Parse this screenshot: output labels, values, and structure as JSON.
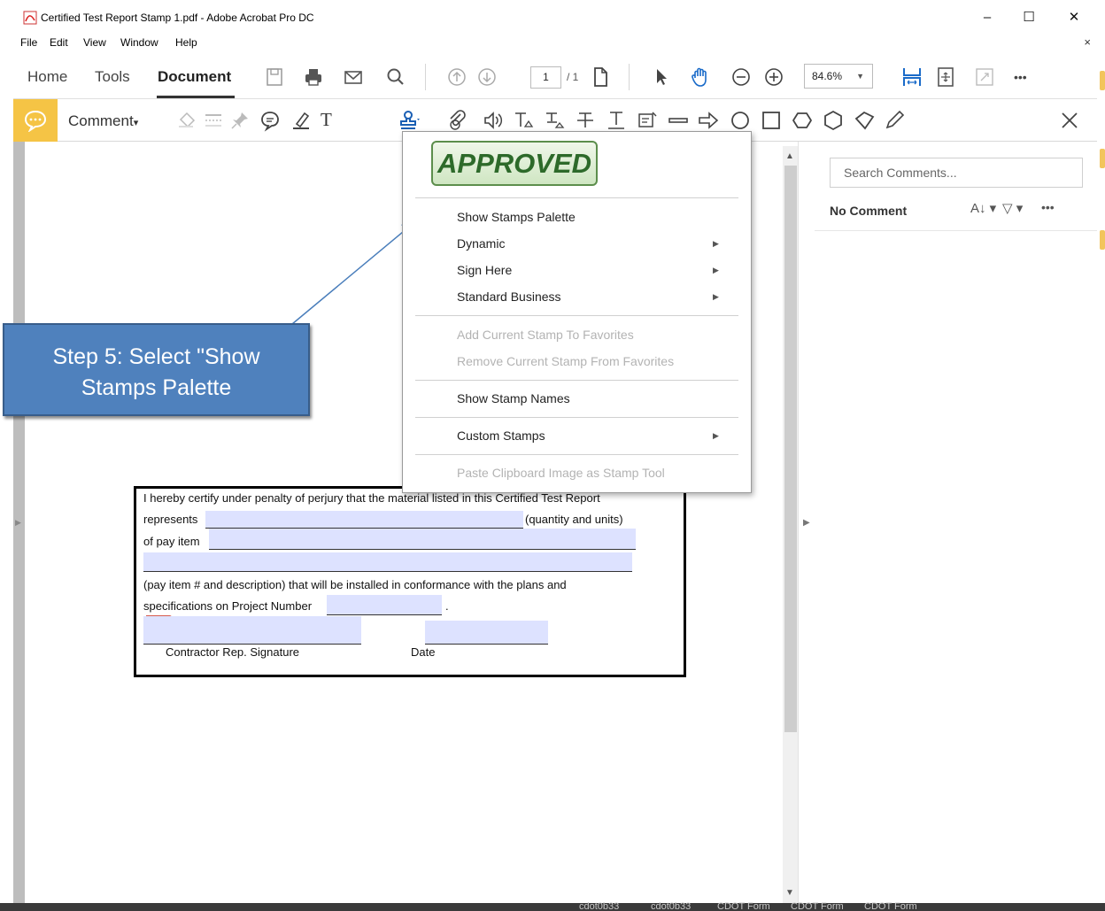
{
  "window": {
    "title": "Certified Test Report Stamp 1.pdf - Adobe Acrobat Pro DC",
    "minimize": "–",
    "maximize": "☐",
    "close": "✕"
  },
  "menu": {
    "items": [
      "File",
      "Edit",
      "View",
      "Window",
      "Help"
    ],
    "close": "×"
  },
  "toolbar": {
    "tabs": [
      "Home",
      "Tools",
      "Document"
    ],
    "active_tab": "Document",
    "page_current": "1",
    "page_total": "/ 1",
    "zoom": "84.6%",
    "more": "•••"
  },
  "comment_toolbar": {
    "label": "Comment",
    "label_arrow": "▾"
  },
  "stamp_menu": {
    "preview_stamp": "APPROVED",
    "items": [
      {
        "label": "Show Stamps Palette",
        "submenu": false,
        "enabled": true
      },
      {
        "label": "Dynamic",
        "submenu": true,
        "enabled": true
      },
      {
        "label": "Sign Here",
        "submenu": true,
        "enabled": true
      },
      {
        "label": "Standard Business",
        "submenu": true,
        "enabled": true
      },
      {
        "label": "Add Current Stamp To Favorites",
        "submenu": false,
        "enabled": false
      },
      {
        "label": "Remove Current Stamp From Favorites",
        "submenu": false,
        "enabled": false
      },
      {
        "label": "Show Stamp Names",
        "submenu": false,
        "enabled": true
      },
      {
        "label": "Custom Stamps",
        "submenu": true,
        "enabled": true
      },
      {
        "label": "Paste Clipboard Image as Stamp Tool",
        "submenu": false,
        "enabled": false
      }
    ]
  },
  "callout": {
    "line1": "Step 5: Select \"Show",
    "line2": "Stamps Palette"
  },
  "right_panel": {
    "search_placeholder": "Search Comments...",
    "no_comment": "No Comment"
  },
  "form": {
    "line1": "I hereby certify under penalty of perjury that the material listed in this Certified Test Report",
    "represents": "represents",
    "quantity_units": "(quantity and units)",
    "of_pay_item": "of pay item",
    "pay_item_desc": "(pay item # and description)  that will be installed in conformance with the plans and",
    "specs": "specifications on Project Number",
    "period": ".",
    "signature_label": "Contractor Rep. Signature",
    "date_label": "Date"
  },
  "taskbar_bits": [
    "cdot0b33",
    "cdot0b33",
    "CDOT Form",
    "CDOT Form",
    "CDOT Form"
  ],
  "colors": {
    "comment_accent": "#f5c445",
    "callout_fill": "#4f81bd",
    "form_field": "#dde2ff",
    "approved_green": "#2d6a2a"
  }
}
